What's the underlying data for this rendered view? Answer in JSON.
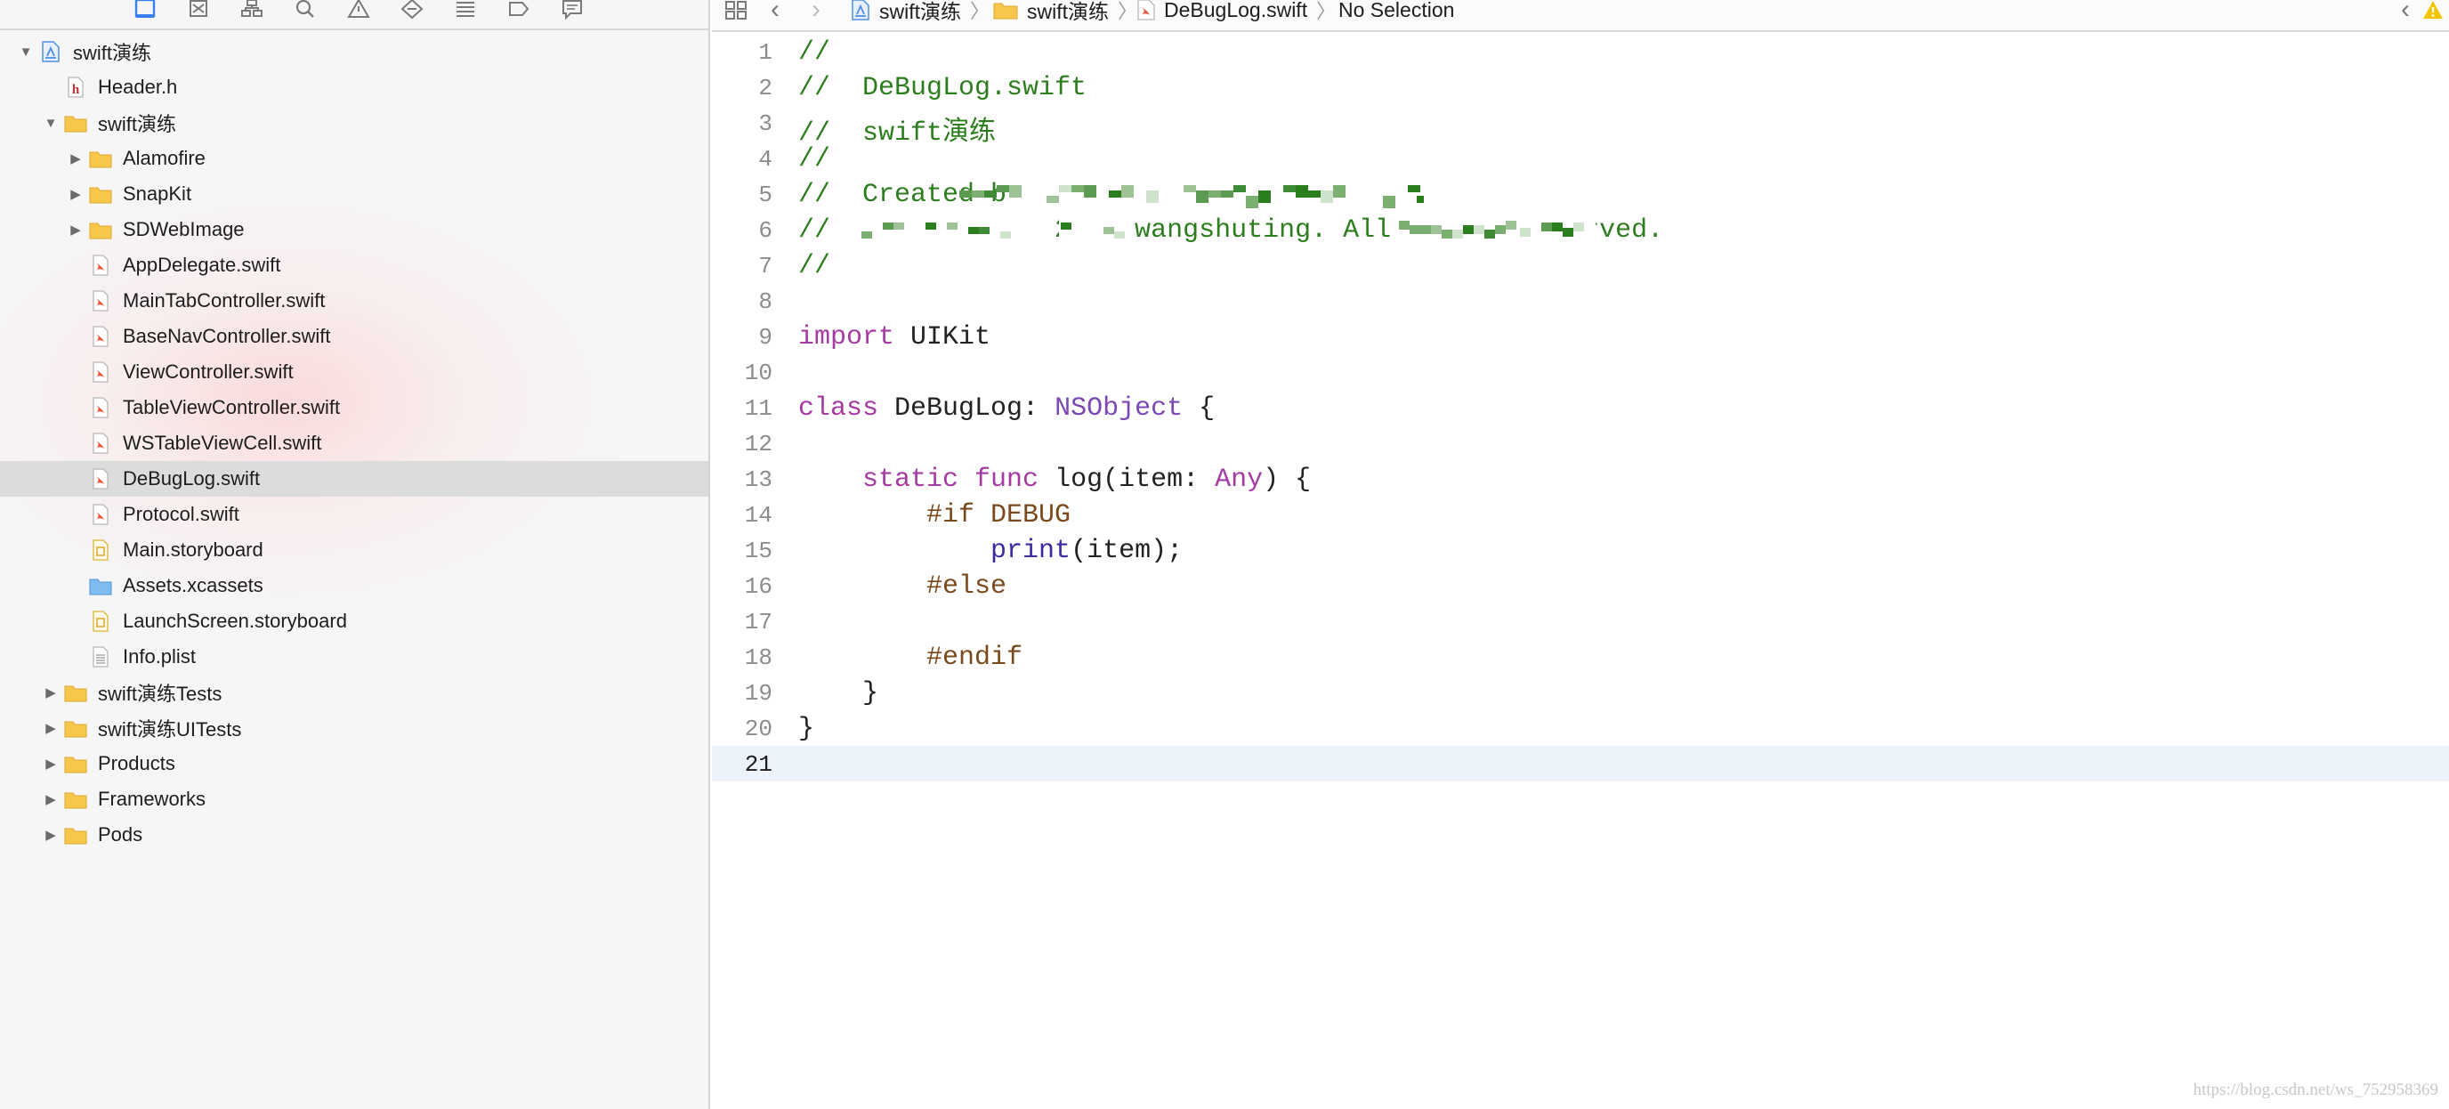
{
  "navigator": {
    "toolbar_icons": [
      "project-navigator-icon",
      "source-control-icon",
      "symbol-navigator-icon",
      "find-navigator-icon",
      "issue-navigator-icon",
      "test-navigator-icon",
      "debug-navigator-icon",
      "breakpoint-navigator-icon",
      "report-navigator-icon"
    ],
    "tree": [
      {
        "label": "swift演练",
        "kind": "project",
        "depth": 0,
        "disclosure": "open",
        "selected": false
      },
      {
        "label": "Header.h",
        "kind": "header",
        "depth": 1,
        "disclosure": "none",
        "selected": false
      },
      {
        "label": "swift演练",
        "kind": "folder",
        "depth": 1,
        "disclosure": "open",
        "selected": false
      },
      {
        "label": "Alamofire",
        "kind": "folder",
        "depth": 2,
        "disclosure": "closed",
        "selected": false
      },
      {
        "label": "SnapKit",
        "kind": "folder",
        "depth": 2,
        "disclosure": "closed",
        "selected": false
      },
      {
        "label": "SDWebImage",
        "kind": "folder",
        "depth": 2,
        "disclosure": "closed",
        "selected": false
      },
      {
        "label": "AppDelegate.swift",
        "kind": "swift",
        "depth": 2,
        "disclosure": "none",
        "selected": false
      },
      {
        "label": "MainTabController.swift",
        "kind": "swift",
        "depth": 2,
        "disclosure": "none",
        "selected": false
      },
      {
        "label": "BaseNavController.swift",
        "kind": "swift",
        "depth": 2,
        "disclosure": "none",
        "selected": false
      },
      {
        "label": "ViewController.swift",
        "kind": "swift",
        "depth": 2,
        "disclosure": "none",
        "selected": false
      },
      {
        "label": "TableViewController.swift",
        "kind": "swift",
        "depth": 2,
        "disclosure": "none",
        "selected": false
      },
      {
        "label": "WSTableViewCell.swift",
        "kind": "swift",
        "depth": 2,
        "disclosure": "none",
        "selected": false
      },
      {
        "label": "DeBugLog.swift",
        "kind": "swift",
        "depth": 2,
        "disclosure": "none",
        "selected": true
      },
      {
        "label": "Protocol.swift",
        "kind": "swift",
        "depth": 2,
        "disclosure": "none",
        "selected": false
      },
      {
        "label": "Main.storyboard",
        "kind": "storyboard",
        "depth": 2,
        "disclosure": "none",
        "selected": false
      },
      {
        "label": "Assets.xcassets",
        "kind": "assets",
        "depth": 2,
        "disclosure": "none",
        "selected": false
      },
      {
        "label": "LaunchScreen.storyboard",
        "kind": "storyboard",
        "depth": 2,
        "disclosure": "none",
        "selected": false
      },
      {
        "label": "Info.plist",
        "kind": "plist",
        "depth": 2,
        "disclosure": "none",
        "selected": false
      },
      {
        "label": "swift演练Tests",
        "kind": "folder",
        "depth": 1,
        "disclosure": "closed",
        "selected": false
      },
      {
        "label": "swift演练UITests",
        "kind": "folder",
        "depth": 1,
        "disclosure": "closed",
        "selected": false
      },
      {
        "label": "Products",
        "kind": "folder",
        "depth": 1,
        "disclosure": "closed",
        "selected": false
      },
      {
        "label": "Frameworks",
        "kind": "folder",
        "depth": 1,
        "disclosure": "closed",
        "selected": false
      },
      {
        "label": "Pods",
        "kind": "folder",
        "depth": 1,
        "disclosure": "closed",
        "selected": false
      }
    ]
  },
  "jumpbar": {
    "items": [
      "swift演练",
      "swift演练",
      "DeBugLog.swift",
      "No Selection"
    ]
  },
  "editor": {
    "current_line": 21,
    "lines": [
      {
        "n": "1",
        "tokens": [
          {
            "t": "//",
            "c": "comment"
          }
        ]
      },
      {
        "n": "2",
        "tokens": [
          {
            "t": "//  DeBugLog.swift",
            "c": "comment"
          }
        ]
      },
      {
        "n": "3",
        "tokens": [
          {
            "t": "//  swift演练",
            "c": "comment"
          }
        ]
      },
      {
        "n": "4",
        "tokens": [
          {
            "t": "//",
            "c": "comment"
          }
        ]
      },
      {
        "n": "5",
        "tokens": [
          {
            "t": "//  Created b",
            "c": "comment"
          }
        ]
      },
      {
        "n": "6",
        "tokens": [
          {
            "t": "//  Copyright © 2016 wangshuting. All rights reserved.",
            "c": "comment"
          }
        ]
      },
      {
        "n": "7",
        "tokens": [
          {
            "t": "//",
            "c": "comment"
          }
        ]
      },
      {
        "n": "8",
        "tokens": []
      },
      {
        "n": "9",
        "tokens": [
          {
            "t": "import",
            "c": "keyword"
          },
          {
            "t": " UIKit",
            "c": "ident"
          }
        ]
      },
      {
        "n": "10",
        "tokens": []
      },
      {
        "n": "11",
        "tokens": [
          {
            "t": "class",
            "c": "keyword"
          },
          {
            "t": " DeBugLog: ",
            "c": "ident"
          },
          {
            "t": "NSObject",
            "c": "type"
          },
          {
            "t": " {",
            "c": "plain"
          }
        ]
      },
      {
        "n": "12",
        "tokens": []
      },
      {
        "n": "13",
        "tokens": [
          {
            "t": "    static",
            "c": "keyword"
          },
          {
            "t": " ",
            "c": "plain"
          },
          {
            "t": "func",
            "c": "keyword"
          },
          {
            "t": " log(item: ",
            "c": "ident"
          },
          {
            "t": "Any",
            "c": "keyword"
          },
          {
            "t": ") {",
            "c": "plain"
          }
        ]
      },
      {
        "n": "14",
        "tokens": [
          {
            "t": "        #if DEBUG",
            "c": "directive"
          }
        ]
      },
      {
        "n": "15",
        "tokens": [
          {
            "t": "            ",
            "c": "plain"
          },
          {
            "t": "print",
            "c": "func"
          },
          {
            "t": "(item);",
            "c": "plain"
          }
        ]
      },
      {
        "n": "16",
        "tokens": [
          {
            "t": "        #else",
            "c": "directive"
          }
        ]
      },
      {
        "n": "17",
        "tokens": []
      },
      {
        "n": "18",
        "tokens": [
          {
            "t": "        #endif",
            "c": "directive"
          }
        ]
      },
      {
        "n": "19",
        "tokens": [
          {
            "t": "    }",
            "c": "plain"
          }
        ]
      },
      {
        "n": "20",
        "tokens": [
          {
            "t": "}",
            "c": "plain"
          }
        ]
      },
      {
        "n": "21",
        "tokens": []
      }
    ]
  },
  "watermark": "https://blog.csdn.net/ws_752958369",
  "colors": {
    "comment": "#2c7d1e",
    "keyword": "#a63aa3",
    "type": "#7a47b3",
    "func": "#3a2c9e",
    "directive": "#7b4a1c",
    "selection": "#dcdcdc",
    "current_line": "#ecf3fb"
  }
}
